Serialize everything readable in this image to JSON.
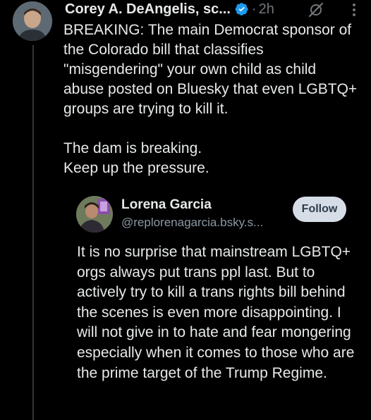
{
  "post": {
    "author_name": "Corey A. DeAngelis, sc...",
    "verified_icon": "verified-badge-icon",
    "separator": "·",
    "time": "2h",
    "grok_icon": "grok-icon",
    "more_icon": "more-options-icon",
    "text": "BREAKING: The main Democrat sponsor of the Colorado bill that classifies \"misgendering\" your own child as child abuse posted on Bluesky that even LGBTQ+ groups are trying to kill it.\n\nThe dam is breaking.\nKeep up the pressure."
  },
  "quoted_screenshot": {
    "author_name": "Lorena Garcia",
    "handle": "@replorenagarcia.bsky.s...",
    "follow_label": "Follow",
    "text": "It is no surprise that mainstream LGBTQ+ orgs always put trans ppl last. But to actively try to kill a trans rights bill behind the scenes is even more disappointing. I will not give in to hate and fear mongering especially when it comes to those who are the prime target of the Trump Regime."
  },
  "colors": {
    "background": "#000000",
    "primary_text": "#e7e9ea",
    "secondary_text": "#71767b",
    "verified_blue": "#1d9bf0",
    "follow_button_bg": "#d6dde7"
  }
}
